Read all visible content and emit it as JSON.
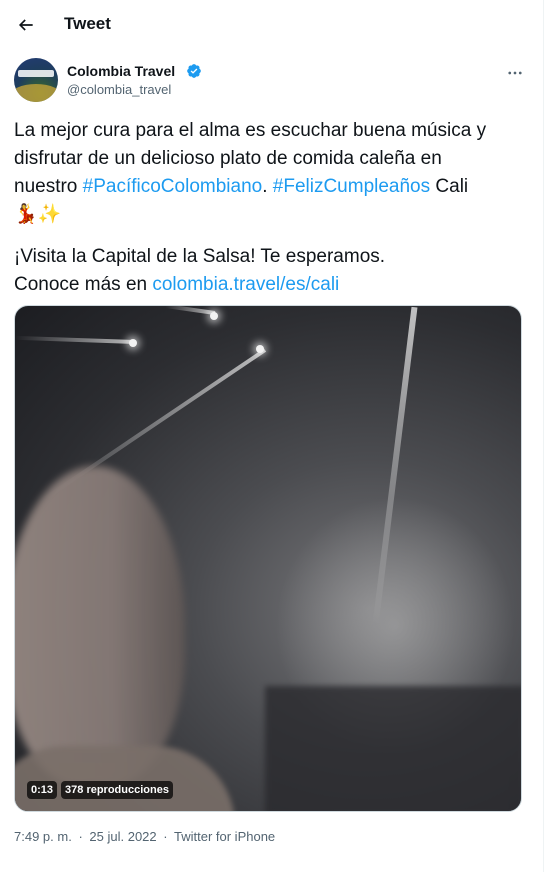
{
  "header": {
    "title": "Tweet",
    "back_icon": "arrow-left-icon"
  },
  "author": {
    "name": "Colombia Travel",
    "handle": "@colombia_travel",
    "verified_icon": "verified-badge-icon",
    "verified_color": "#1d9bf0",
    "more_icon": "more-horizontal-icon"
  },
  "tweet": {
    "text_1": "La mejor cura para el alma es escuchar buena música y",
    "text_2": "disfrutar de un delicioso plato de comida caleña en",
    "text_3_prefix": "nuestro ",
    "hashtag_1": "#PacíficoColombiano",
    "text_3_sep": ". ",
    "hashtag_2": "#FelizCumpleaños",
    "text_3_suffix": " Cali",
    "emoji": "💃✨",
    "text_4": "¡Visita la Capital de la Salsa! Te esperamos.",
    "text_5_prefix": "Conoce más en ",
    "link": "colombia.travel/es/cali",
    "link_color": "#1d9bf0"
  },
  "media": {
    "duration": "0:13",
    "views": "378 reproducciones"
  },
  "meta": {
    "time": "7:49 p. m.",
    "separator_1": "·",
    "date": "25 jul. 2022",
    "separator_2": "·",
    "source": "Twitter for iPhone"
  }
}
